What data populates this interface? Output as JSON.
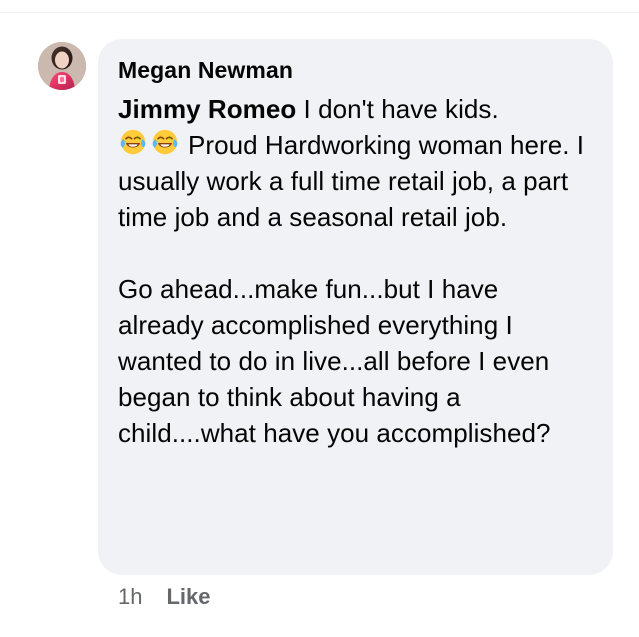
{
  "comment": {
    "author": "Megan Newman",
    "mention": "Jimmy Romeo",
    "lines": [
      " I don't have kids.",
      "Proud Hardworking woman here. I usually work a full time retail job, a part time job and a seasonal retail job.",
      "Go ahead...make fun...but I have already accomplished everything I wanted to do in live...all before I even began to think about having a child....what have you accomplished?"
    ],
    "time": "1h",
    "like_label": "Like"
  },
  "icons": {
    "avatar": "profile-photo",
    "emoji_1": "face-with-tears-of-joy-icon",
    "emoji_2": "face-with-tears-of-joy-icon"
  },
  "colors": {
    "bubble_bg": "#f0f2f5",
    "text_primary": "#050505",
    "text_secondary": "#65676b"
  }
}
